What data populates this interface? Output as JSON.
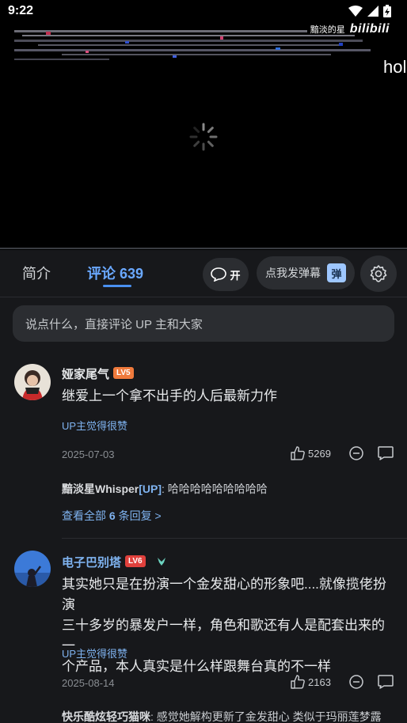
{
  "status_bar": {
    "time": "9:22"
  },
  "video": {
    "watermark_author": "黯淡的星",
    "watermark_brand": "bilibili",
    "danmaku_text": "hol"
  },
  "tabs": {
    "intro": "简介",
    "comments": "评论 639"
  },
  "danmaku_toggle": {
    "label": "开"
  },
  "send_danmaku": {
    "label": "点我发弹幕",
    "badge": "弹"
  },
  "comment_input": {
    "placeholder": "说点什么，直接评论 UP 主和大家"
  },
  "comments": [
    {
      "username": "娅家尾气",
      "level": "LV5",
      "level_color": "#f07a3c",
      "content": "继爱上一个拿不出手的人后最新力作",
      "up_liked": "UP主觉得很赞",
      "date": "2025-07-03",
      "likes": "5269",
      "reply_author": "黯淡星Whisper",
      "reply_up_tag": "[UP]",
      "reply_text": ": 哈哈哈哈哈哈哈哈哈",
      "view_all_prefix": "查看全部 ",
      "view_all_count": "6",
      "view_all_suffix": " 条回复 >"
    },
    {
      "username": "电子巴别塔",
      "level": "LV6",
      "level_color": "#e0403c",
      "content_lines": [
        "其实她只是在扮演一个金发甜心的形象吧....就像揽佬扮演",
        "三十多岁的暴发户一样，角色和歌还有人是配套出来的一",
        "个产品，本人真实是什么样跟舞台真的不一样"
      ],
      "up_liked": "UP主觉得很赞",
      "date": "2025-08-14",
      "likes": "2163",
      "reply_author": "快乐酷炫轻巧猫咪",
      "reply_text": ": 感觉她解构更新了金发甜心 类似于玛丽莲梦露"
    }
  ]
}
